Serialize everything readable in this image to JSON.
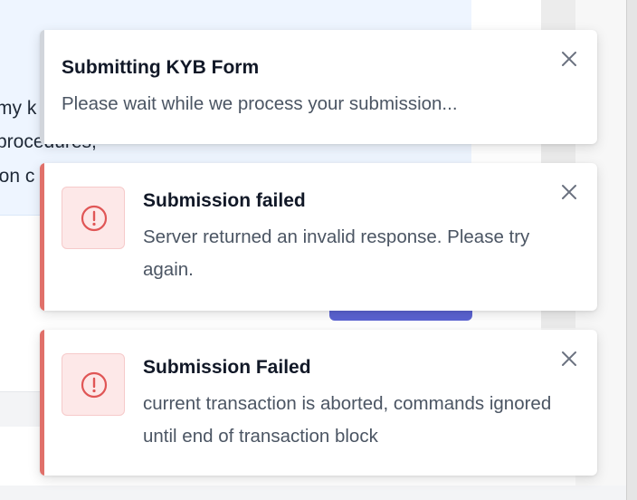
{
  "background": {
    "text_lines": [
      "my k",
      "procedures,",
      "ion c"
    ]
  },
  "toasts": [
    {
      "kind": "info",
      "title": "Submitting KYB Form",
      "message": "Please wait while we process your submission...",
      "close_icon": "close-icon"
    },
    {
      "kind": "error",
      "icon": "alert-circle-icon",
      "title": "Submission failed",
      "message": "Server returned an invalid response. Please try again.",
      "close_icon": "close-icon"
    },
    {
      "kind": "error",
      "icon": "alert-circle-icon",
      "title": "Submission Failed",
      "message": "current transaction is aborted, commands ignored until end of transaction block",
      "close_icon": "close-icon"
    }
  ],
  "colors": {
    "error_accent": "#e0706a",
    "error_icon": "#e05656",
    "info_accent": "#d1d5db",
    "background_panel": "#eef5ff",
    "primary_button": "#5b63d3"
  }
}
